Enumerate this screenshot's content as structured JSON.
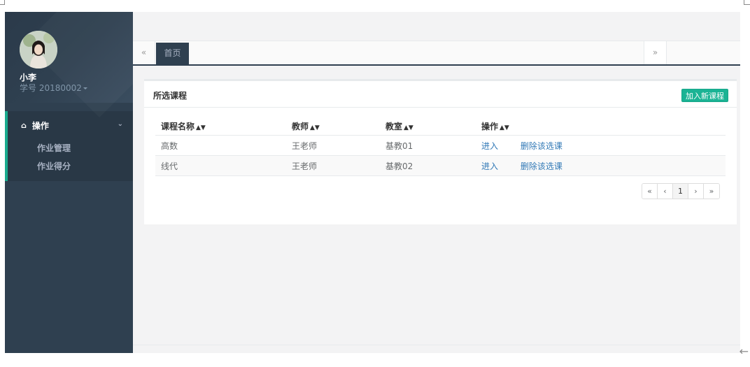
{
  "profile": {
    "name": "小李",
    "student_id": "学号 20180002"
  },
  "nav": {
    "group_label": "操作",
    "items": [
      {
        "label": "作业管理"
      },
      {
        "label": "作业得分"
      }
    ]
  },
  "tabs": {
    "prev": "«",
    "home": "首页",
    "next": "»"
  },
  "panel": {
    "title": "所选课程",
    "add_button": "加入新课程"
  },
  "table": {
    "columns": [
      "课程名称",
      "教师",
      "教室",
      "操作"
    ],
    "rows": [
      {
        "course": "高数",
        "teacher": "王老师",
        "room": "基教01",
        "enter": "进入",
        "remove": "删除该选课"
      },
      {
        "course": "线代",
        "teacher": "王老师",
        "room": "基教02",
        "enter": "进入",
        "remove": "删除该选课"
      }
    ]
  },
  "pagination": {
    "first": "«",
    "prev": "‹",
    "current": "1",
    "next": "›",
    "last": "»"
  },
  "colors": {
    "sidebar": "#2f4050",
    "accent": "#1ab394",
    "link": "#337ab7"
  }
}
